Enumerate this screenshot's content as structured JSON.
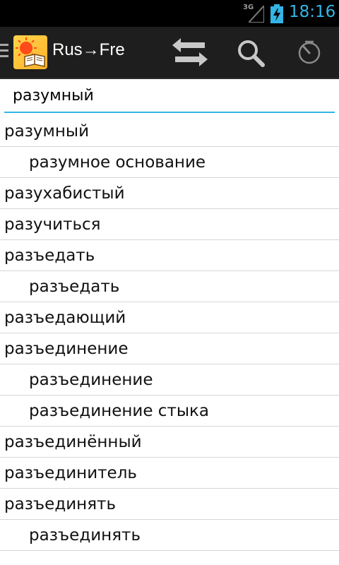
{
  "status": {
    "network": "3G",
    "time": "18:16",
    "accent": "#33b5e5"
  },
  "actionbar": {
    "title": "Rus→Fre",
    "icons": [
      "drawer-icon",
      "app-logo",
      "swap-icon",
      "search-icon",
      "history-icon"
    ]
  },
  "search": {
    "value": "разумный"
  },
  "words": [
    {
      "text": "разумный",
      "level": 0
    },
    {
      "text": "разумное основание",
      "level": 1
    },
    {
      "text": "разухабистый",
      "level": 0
    },
    {
      "text": "разучиться",
      "level": 0
    },
    {
      "text": "разъедать",
      "level": 0
    },
    {
      "text": "разъедать",
      "level": 1
    },
    {
      "text": "разъедающий",
      "level": 0
    },
    {
      "text": "разъединение",
      "level": 0
    },
    {
      "text": "разъединение",
      "level": 1
    },
    {
      "text": "разъединение стыка",
      "level": 1
    },
    {
      "text": "разъединённый",
      "level": 0
    },
    {
      "text": "разъединитель",
      "level": 0
    },
    {
      "text": "разъединять",
      "level": 0
    },
    {
      "text": "разъединять",
      "level": 1
    }
  ]
}
